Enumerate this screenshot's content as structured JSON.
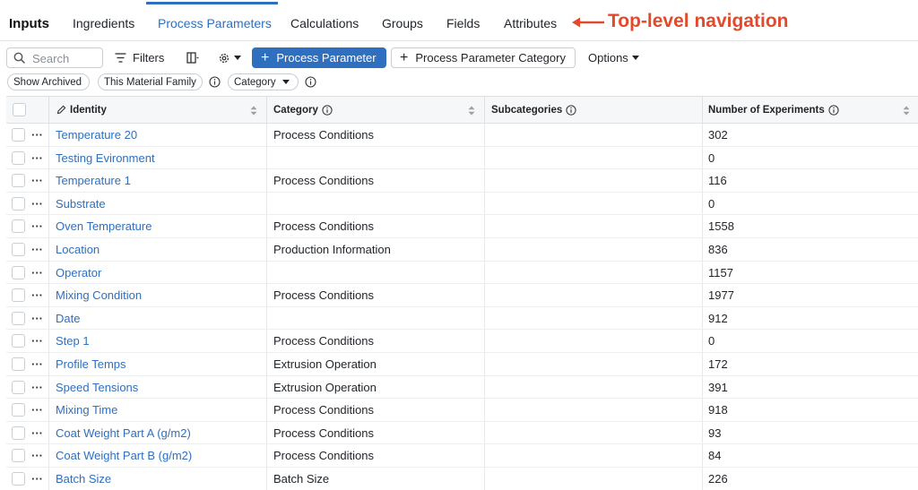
{
  "nav": {
    "title": "Inputs",
    "tabs": [
      {
        "label": "Ingredients"
      },
      {
        "label": "Process Parameters"
      },
      {
        "label": "Calculations"
      },
      {
        "label": "Groups"
      },
      {
        "label": "Fields"
      },
      {
        "label": "Attributes"
      }
    ],
    "active_tab": "Process Parameters",
    "callout": "Top-level navigation"
  },
  "toolbar": {
    "search_placeholder": "Search",
    "filters_label": "Filters",
    "add_parameter_label": "Process Parameter",
    "add_category_label": "Process Parameter Category",
    "options_label": "Options"
  },
  "chips": {
    "show_archived": "Show Archived",
    "material_family": "This Material Family",
    "category": "Category"
  },
  "table": {
    "columns": [
      "Identity",
      "Category",
      "Subcategories",
      "Number of Experiments"
    ],
    "rows": [
      {
        "identity": "Temperature 20",
        "category": "Process Conditions",
        "subcategories": "",
        "experiments": "302"
      },
      {
        "identity": "Testing Evironment",
        "category": "",
        "subcategories": "",
        "experiments": "0"
      },
      {
        "identity": "Temperature 1",
        "category": "Process Conditions",
        "subcategories": "",
        "experiments": "116"
      },
      {
        "identity": "Substrate",
        "category": "",
        "subcategories": "",
        "experiments": "0"
      },
      {
        "identity": "Oven Temperature",
        "category": "Process Conditions",
        "subcategories": "",
        "experiments": "1558"
      },
      {
        "identity": "Location",
        "category": "Production Information",
        "subcategories": "",
        "experiments": "836"
      },
      {
        "identity": "Operator",
        "category": "",
        "subcategories": "",
        "experiments": "1157"
      },
      {
        "identity": "Mixing Condition",
        "category": "Process Conditions",
        "subcategories": "",
        "experiments": "1977"
      },
      {
        "identity": "Date",
        "category": "",
        "subcategories": "",
        "experiments": "912"
      },
      {
        "identity": "Step 1",
        "category": "Process Conditions",
        "subcategories": "",
        "experiments": "0"
      },
      {
        "identity": "Profile Temps",
        "category": "Extrusion Operation",
        "subcategories": "",
        "experiments": "172"
      },
      {
        "identity": "Speed Tensions",
        "category": "Extrusion Operation",
        "subcategories": "",
        "experiments": "391"
      },
      {
        "identity": "Mixing Time",
        "category": "Process Conditions",
        "subcategories": "",
        "experiments": "918"
      },
      {
        "identity": "Coat Weight Part A (g/m2)",
        "category": "Process Conditions",
        "subcategories": "",
        "experiments": "93"
      },
      {
        "identity": "Coat Weight Part B (g/m2)",
        "category": "Process Conditions",
        "subcategories": "",
        "experiments": "84"
      },
      {
        "identity": "Batch Size",
        "category": "Batch Size",
        "subcategories": "",
        "experiments": "226"
      }
    ]
  },
  "colors": {
    "accent": "#2f6fbf",
    "callout": "#e3492b"
  }
}
